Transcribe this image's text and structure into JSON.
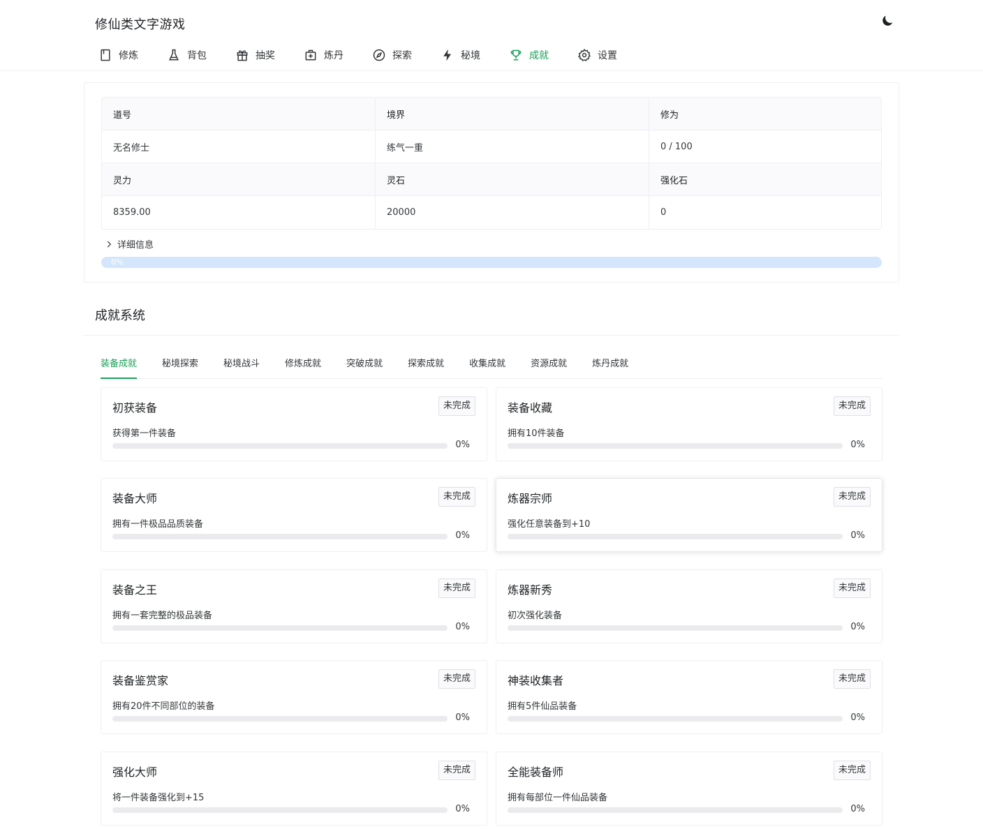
{
  "app": {
    "title": "修仙类文字游戏",
    "theme_icon": "moon-icon"
  },
  "nav": [
    {
      "label": "修炼",
      "icon": "book-icon",
      "active": false
    },
    {
      "label": "背包",
      "icon": "flask-icon",
      "active": false
    },
    {
      "label": "抽奖",
      "icon": "gift-icon",
      "active": false
    },
    {
      "label": "炼丹",
      "icon": "first-aid-kit-icon",
      "active": false
    },
    {
      "label": "探索",
      "icon": "compass-icon",
      "active": false
    },
    {
      "label": "秘境",
      "icon": "bolt-icon",
      "active": false
    },
    {
      "label": "成就",
      "icon": "trophy-icon",
      "active": true
    },
    {
      "label": "设置",
      "icon": "gear-icon",
      "active": false
    }
  ],
  "status": {
    "headers1": [
      "道号",
      "境界",
      "修为"
    ],
    "values1": [
      "无名修士",
      "练气一重",
      "0 / 100"
    ],
    "headers2": [
      "灵力",
      "灵石",
      "强化石"
    ],
    "values2": [
      "8359.00",
      "20000",
      "0"
    ],
    "detail_label": "详细信息",
    "progress": {
      "percent": 0,
      "label": "0%"
    }
  },
  "achievements": {
    "title": "成就系统",
    "tabs": [
      "装备成就",
      "秘境探索",
      "秘境战斗",
      "修炼成就",
      "突破成就",
      "探索成就",
      "收集成就",
      "资源成就",
      "炼丹成就"
    ],
    "active_tab": 0,
    "items": [
      {
        "name": "初获装备",
        "status": "未完成",
        "desc": "获得第一件装备",
        "percent": 0,
        "percent_label": "0%"
      },
      {
        "name": "装备收藏",
        "status": "未完成",
        "desc": "拥有10件装备",
        "percent": 0,
        "percent_label": "0%"
      },
      {
        "name": "装备大师",
        "status": "未完成",
        "desc": "拥有一件极品品质装备",
        "percent": 0,
        "percent_label": "0%"
      },
      {
        "name": "炼器宗师",
        "status": "未完成",
        "desc": "强化任意装备到+10",
        "percent": 0,
        "percent_label": "0%"
      },
      {
        "name": "装备之王",
        "status": "未完成",
        "desc": "拥有一套完整的极品装备",
        "percent": 0,
        "percent_label": "0%"
      },
      {
        "name": "炼器新秀",
        "status": "未完成",
        "desc": "初次强化装备",
        "percent": 0,
        "percent_label": "0%"
      },
      {
        "name": "装备鉴赏家",
        "status": "未完成",
        "desc": "拥有20件不同部位的装备",
        "percent": 0,
        "percent_label": "0%"
      },
      {
        "name": "神装收集者",
        "status": "未完成",
        "desc": "拥有5件仙品装备",
        "percent": 0,
        "percent_label": "0%"
      },
      {
        "name": "强化大师",
        "status": "未完成",
        "desc": "将一件装备强化到+15",
        "percent": 0,
        "percent_label": "0%"
      },
      {
        "name": "全能装备师",
        "status": "未完成",
        "desc": "拥有每部位一件仙品装备",
        "percent": 0,
        "percent_label": "0%"
      }
    ]
  },
  "colors": {
    "accent": "#18a058",
    "progress_track": "#d3e6fb",
    "progress_fill": "#2080f0"
  }
}
